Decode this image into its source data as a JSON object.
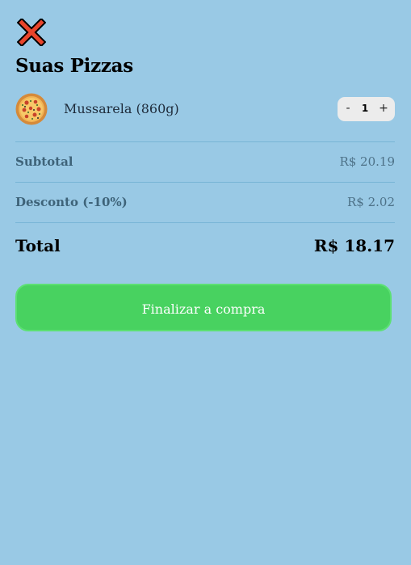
{
  "header": {
    "close_icon": "close-icon",
    "title": "Suas Pizzas"
  },
  "cart": {
    "items": [
      {
        "icon": "pizza-icon",
        "name": "Mussarela (860g)",
        "quantity": "1",
        "minus_label": "-",
        "plus_label": "+"
      }
    ]
  },
  "summary": {
    "subtotal_label": "Subtotal",
    "subtotal_value": "R$ 20.19",
    "discount_label": "Desconto (-10%)",
    "discount_value": "R$ 2.02",
    "total_label": "Total",
    "total_value": "R$ 18.17"
  },
  "actions": {
    "checkout_label": "Finalizar a compra"
  },
  "colors": {
    "background": "#99c9e5",
    "close_icon": "#e8452c",
    "checkout_button": "#48d260",
    "divider": "#78b5d6"
  }
}
